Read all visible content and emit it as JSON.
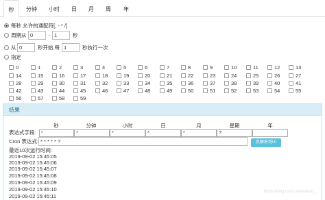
{
  "tabs": [
    "秒",
    "分钟",
    "小时",
    "日",
    "月",
    "周",
    "年"
  ],
  "options": {
    "every": "每秒 允许的通配符[, - * /]",
    "range_prefix": "周期从",
    "range_from": "0",
    "range_dash": "-",
    "range_to": "1",
    "range_unit": "秒",
    "step_prefix": "从",
    "step_start": "0",
    "step_mid": "秒开始,每",
    "step_interval": "1",
    "step_suffix": "秒执行一次",
    "specify": "指定"
  },
  "seconds": [
    "0",
    "1",
    "2",
    "3",
    "4",
    "5",
    "6",
    "7",
    "8",
    "9",
    "10",
    "11",
    "12",
    "13",
    "14",
    "15",
    "16",
    "17",
    "18",
    "19",
    "20",
    "21",
    "22",
    "23",
    "24",
    "25",
    "26",
    "27",
    "28",
    "29",
    "30",
    "31",
    "32",
    "33",
    "34",
    "35",
    "36",
    "37",
    "38",
    "39",
    "40",
    "41",
    "42",
    "43",
    "44",
    "45",
    "46",
    "47",
    "48",
    "49",
    "50",
    "51",
    "52",
    "53",
    "54",
    "55",
    "56",
    "57",
    "58",
    "59"
  ],
  "result": {
    "title": "结果",
    "columns": [
      "秒",
      "分钟",
      "小时",
      "日",
      "月",
      "星期",
      "年"
    ],
    "field_label": "表达式字段:",
    "fields": [
      "*",
      "*",
      "*",
      "*",
      "*",
      "?",
      ""
    ],
    "cron_label": "Cron 表达式:",
    "cron_value": "* * * * * ?",
    "parse_button": "反解析到UI",
    "runs_label": "最近10次运行时间:",
    "runs": [
      "2019-09-02 15:45:05",
      "2019-09-02 15:45:06",
      "2019-09-02 15:45:07",
      "2019-09-02 15:45:08",
      "2019-09-02 15:45:09",
      "2019-09-02 15:45:10",
      "2019-09-02 15:45:11"
    ]
  },
  "watermark": "https://blog.csdn.net/weixin_..."
}
